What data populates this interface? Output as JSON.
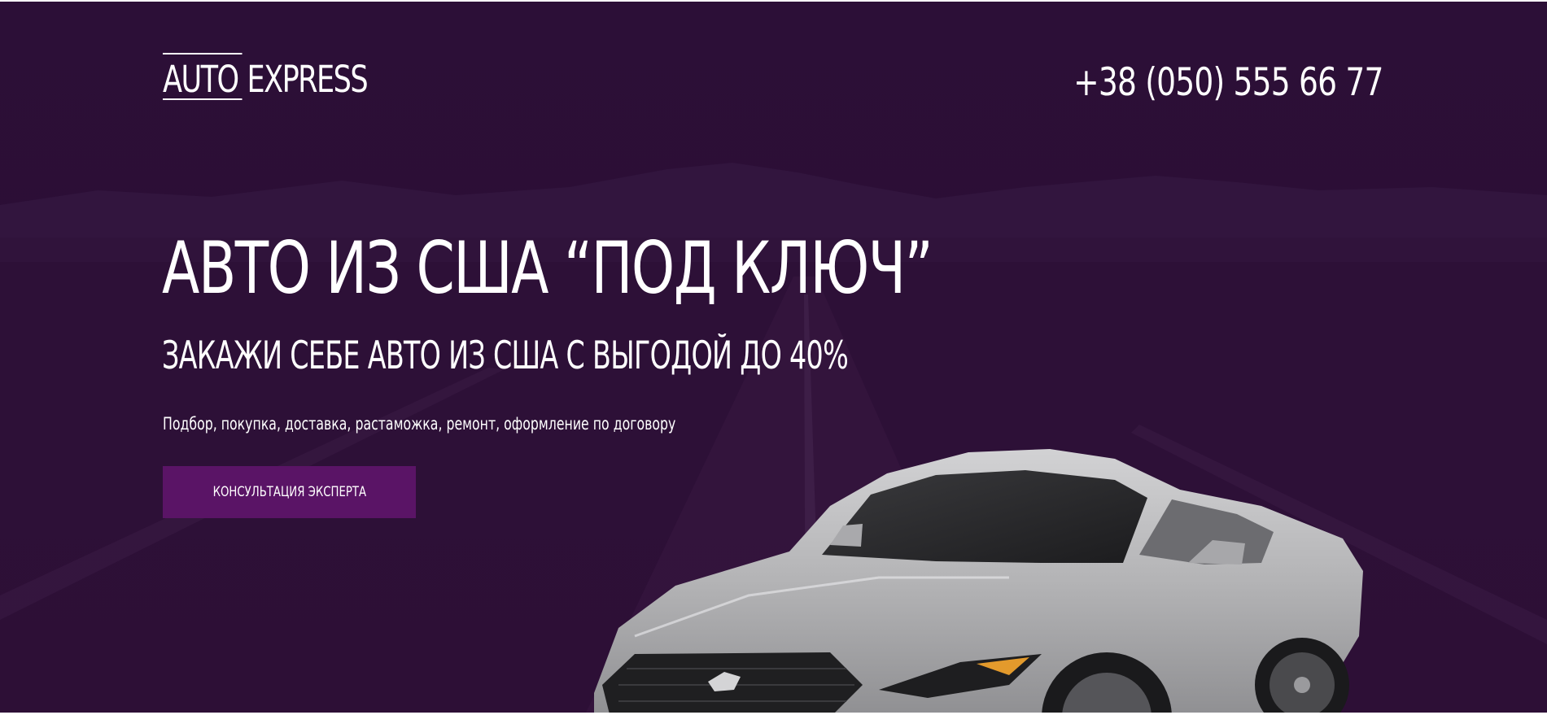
{
  "header": {
    "logo": {
      "part1": "AUTO",
      "part2": "EXPRESS"
    },
    "phone": "+38 (050) 555 66 77"
  },
  "hero": {
    "headline": "АВТО ИЗ США “ПОД КЛЮЧ”",
    "subheadline": "ЗАКАЖИ СЕБЕ АВТО ИЗ США С ВЫГОДОЙ ДО 40%",
    "description": "Подбор, покупка, доставка, растаможка, ремонт, оформление по договору",
    "cta_label": "КОНСУЛЬТАЦИЯ ЭКСПЕРТА"
  },
  "colors": {
    "background": "#2d1038",
    "accent": "#5a1466",
    "text": "#ffffff",
    "car": "#b7b7b9"
  },
  "icons": [
    "road-background-image",
    "mustang-car-image",
    "pony-badge-icon"
  ]
}
